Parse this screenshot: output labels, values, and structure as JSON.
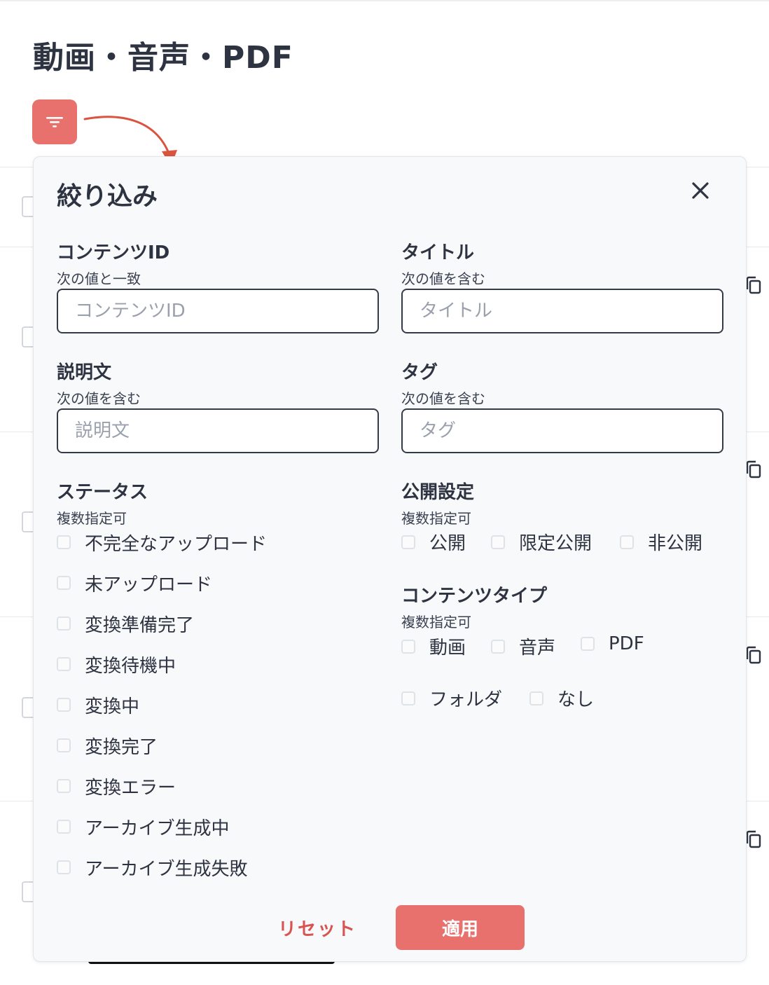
{
  "page": {
    "title": "動画・音声・PDF"
  },
  "filter_button": {
    "icon": "filter-icon",
    "color": "#e8706d"
  },
  "panel": {
    "title": "絞り込み",
    "close_icon": "close-icon",
    "content_id": {
      "label": "コンテンツID",
      "sub": "次の値と一致",
      "placeholder": "コンテンツID",
      "value": ""
    },
    "title_field": {
      "label": "タイトル",
      "sub": "次の値を含む",
      "placeholder": "タイトル",
      "value": ""
    },
    "description": {
      "label": "説明文",
      "sub": "次の値を含む",
      "placeholder": "説明文",
      "value": ""
    },
    "tag": {
      "label": "タグ",
      "sub": "次の値を含む",
      "placeholder": "タグ",
      "value": ""
    },
    "status": {
      "label": "ステータス",
      "sub": "複数指定可",
      "options": [
        {
          "label": "不完全なアップロード",
          "checked": false
        },
        {
          "label": "未アップロード",
          "checked": false
        },
        {
          "label": "変換準備完了",
          "checked": false
        },
        {
          "label": "変換待機中",
          "checked": false
        },
        {
          "label": "変換中",
          "checked": false
        },
        {
          "label": "変換完了",
          "checked": false
        },
        {
          "label": "変換エラー",
          "checked": false
        },
        {
          "label": "アーカイブ生成中",
          "checked": false
        },
        {
          "label": "アーカイブ生成失敗",
          "checked": false
        }
      ]
    },
    "visibility": {
      "label": "公開設定",
      "sub": "複数指定可",
      "options": [
        {
          "label": "公開",
          "checked": false
        },
        {
          "label": "限定公開",
          "checked": false
        },
        {
          "label": "非公開",
          "checked": false
        }
      ]
    },
    "content_type": {
      "label": "コンテンツタイプ",
      "sub": "複数指定可",
      "options": [
        {
          "label": "動画",
          "checked": false
        },
        {
          "label": "音声",
          "checked": false
        },
        {
          "label": "PDF",
          "checked": false
        },
        {
          "label": "フォルダ",
          "checked": false
        },
        {
          "label": "なし",
          "checked": false
        }
      ]
    },
    "reset_label": "リセット",
    "apply_label": "適用"
  },
  "colors": {
    "accent": "#e8706d",
    "reset_text": "#d9544f",
    "panel_bg": "#f8f9fb",
    "text": "#2d3340"
  }
}
